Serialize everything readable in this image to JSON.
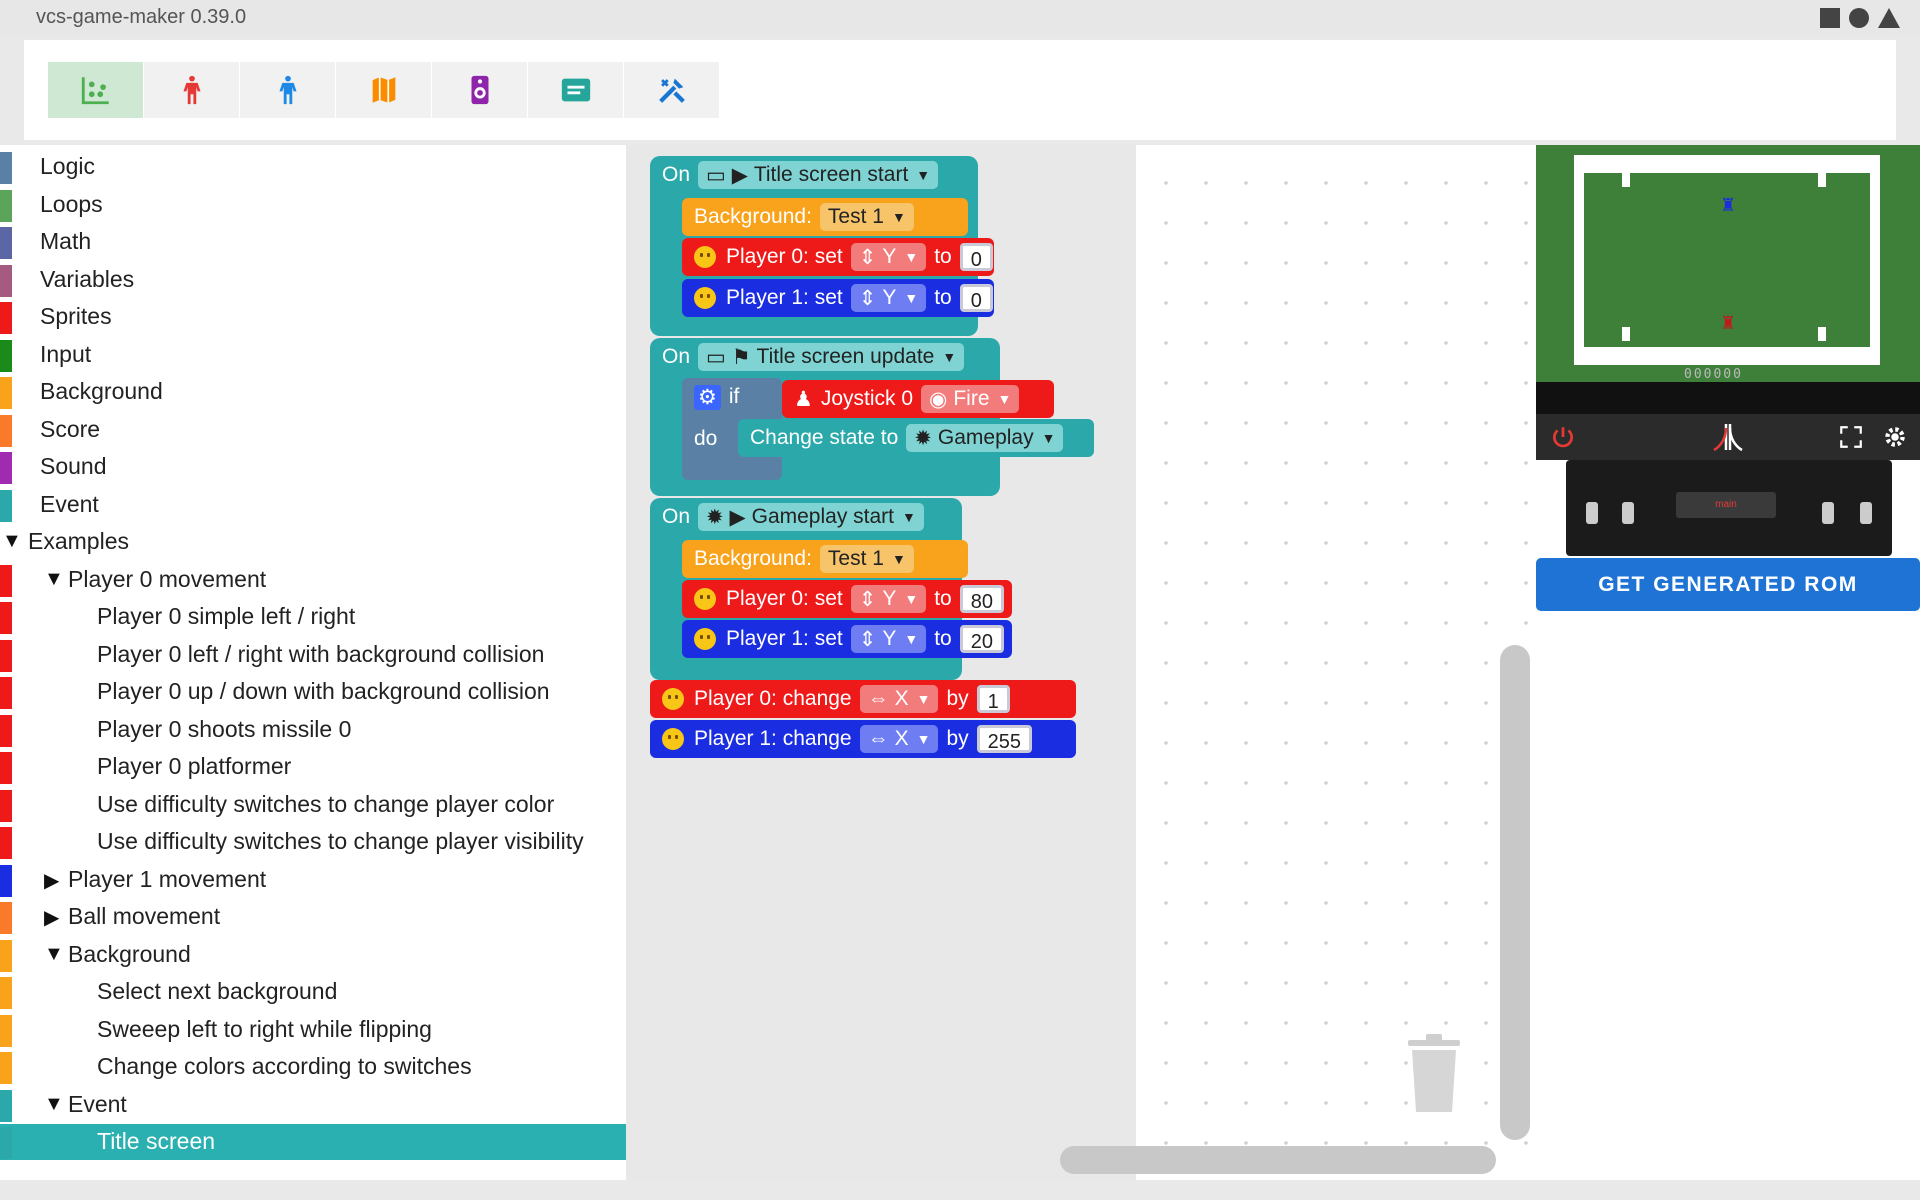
{
  "window": {
    "title": "vcs-game-maker 0.39.0"
  },
  "toolbar": {
    "tabs": [
      {
        "name": "blocks-tab",
        "icon": "scatter-icon",
        "color": "#4caf50"
      },
      {
        "name": "player0-tab",
        "icon": "player0-icon",
        "color": "#e53935"
      },
      {
        "name": "player1-tab",
        "icon": "player1-icon",
        "color": "#1e88e5"
      },
      {
        "name": "playfield-tab",
        "icon": "map-icon",
        "color": "#fb8c00"
      },
      {
        "name": "sound-tab",
        "icon": "speaker-icon",
        "color": "#8e24aa"
      },
      {
        "name": "code-tab",
        "icon": "message-icon",
        "color": "#26a69a"
      },
      {
        "name": "tools-tab",
        "icon": "tools-icon",
        "color": "#1976d2"
      }
    ]
  },
  "categories": [
    {
      "label": "Logic",
      "color": "#5b80a5"
    },
    {
      "label": "Loops",
      "color": "#5ba55b"
    },
    {
      "label": "Math",
      "color": "#5b67a5"
    },
    {
      "label": "Variables",
      "color": "#a55b80"
    },
    {
      "label": "Sprites",
      "color": "#ee1a1a"
    },
    {
      "label": "Input",
      "color": "#1a8a1a"
    },
    {
      "label": "Background",
      "color": "#f9a21b"
    },
    {
      "label": "Score",
      "color": "#f97a2a"
    },
    {
      "label": "Sound",
      "color": "#a02ab0"
    },
    {
      "label": "Event",
      "color": "#2aa8aa"
    }
  ],
  "examples": {
    "label": "Examples",
    "items": [
      {
        "label": "Player 0 movement",
        "level": 1,
        "expanded": true,
        "color": "#ee1a1a"
      },
      {
        "label": "Player 0 simple left / right",
        "level": 2,
        "color": "#ee1a1a"
      },
      {
        "label": "Player 0 left / right with background collision",
        "level": 2,
        "color": "#ee1a1a"
      },
      {
        "label": "Player 0 up / down with background collision",
        "level": 2,
        "color": "#ee1a1a"
      },
      {
        "label": "Player 0 shoots missile 0",
        "level": 2,
        "color": "#ee1a1a"
      },
      {
        "label": "Player 0 platformer",
        "level": 2,
        "color": "#ee1a1a"
      },
      {
        "label": "Use difficulty switches to change player color",
        "level": 2,
        "color": "#ee1a1a"
      },
      {
        "label": "Use difficulty switches to change player visibility",
        "level": 2,
        "color": "#ee1a1a"
      },
      {
        "label": "Player 1 movement",
        "level": 1,
        "expanded": false,
        "color": "#1a2de0"
      },
      {
        "label": "Ball movement",
        "level": 1,
        "expanded": false,
        "color": "#f97a2a"
      },
      {
        "label": "Background",
        "level": 1,
        "expanded": true,
        "color": "#f9a21b"
      },
      {
        "label": "Select next background",
        "level": 2,
        "color": "#f9a21b"
      },
      {
        "label": "Sweeep left to right while flipping",
        "level": 2,
        "color": "#f9a21b"
      },
      {
        "label": "Change colors according to switches",
        "level": 2,
        "color": "#f9a21b"
      },
      {
        "label": "Event",
        "level": 1,
        "expanded": true,
        "color": "#2aa8aa"
      },
      {
        "label": "Title screen",
        "level": 2,
        "selected": true,
        "color": "#2aa8aa"
      }
    ]
  },
  "blocks": {
    "on": "On",
    "event1": "Title screen start",
    "bg_label": "Background:",
    "bg_value": "Test 1",
    "p0_set": "Player 0: set",
    "p1_set": "Player 1: set",
    "axis_y": "Y",
    "axis_x": "X",
    "to": "to",
    "v1": "0",
    "v2": "0",
    "event2": "Title screen update",
    "if": "if",
    "do": "do",
    "joystick": "Joystick 0",
    "fire": "Fire",
    "change_state": "Change state to",
    "gameplay": "Gameplay",
    "event3": "Gameplay start",
    "v3": "80",
    "v4": "20",
    "p0_change": "Player 0: change",
    "p1_change": "Player 1: change",
    "by": "by",
    "v5": "1",
    "v6": "255"
  },
  "emulator": {
    "score": "000000",
    "console_label": "main",
    "rom_button": "GET GENERATED ROM"
  }
}
